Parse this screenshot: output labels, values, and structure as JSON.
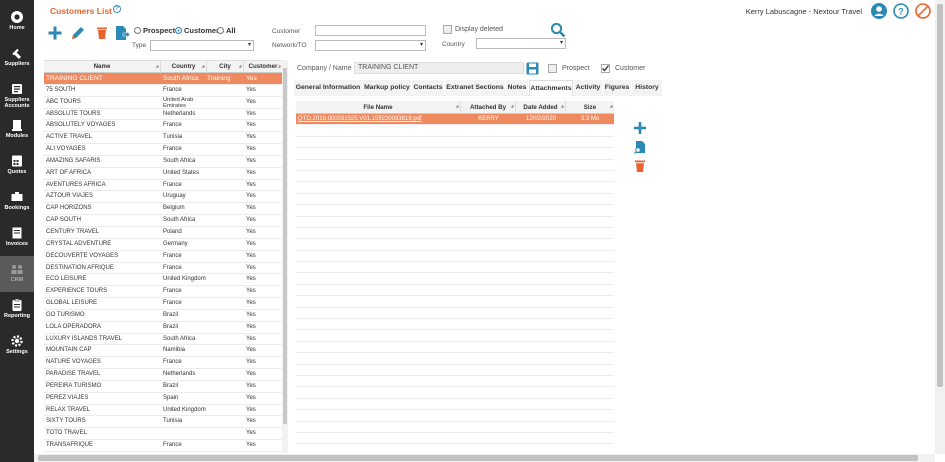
{
  "app": {
    "page_title": "Customers List",
    "user_name": "Kerry Labuscagne - Nextour Travel"
  },
  "colors": {
    "accent": "#e8632f",
    "selected_row": "#ef8a5e",
    "brand_blue": "#2a8ab5",
    "nav_bg": "#2a2a2a",
    "danger": "#e8632f"
  },
  "nav": [
    {
      "label": "Home",
      "icon": "home-icon"
    },
    {
      "label": "Suppliers",
      "icon": "suppliers-icon"
    },
    {
      "label": "Suppliers Accounts",
      "icon": "suppliers-accounts-icon"
    },
    {
      "label": "Modules",
      "icon": "modules-icon"
    },
    {
      "label": "Quotes",
      "icon": "quotes-icon"
    },
    {
      "label": "Bookings",
      "icon": "bookings-icon"
    },
    {
      "label": "Invoices",
      "icon": "invoices-icon"
    },
    {
      "label": "CRM",
      "icon": "crm-icon"
    },
    {
      "label": "Reporting",
      "icon": "reporting-icon"
    },
    {
      "label": "Settings",
      "icon": "settings-icon"
    }
  ],
  "filters": {
    "radio_prospect": "Prospect",
    "radio_customer": "Customer",
    "radio_all": "All",
    "type_label": "Type",
    "customer_label": "Customer",
    "network_label": "Network/TO",
    "display_deleted": "Display deleted",
    "country_label": "Country"
  },
  "list": {
    "headers": {
      "name": "Name",
      "country": "Country",
      "city": "City",
      "customer": "Customer"
    },
    "rows": [
      {
        "name": "TRAINING CLIENT",
        "country": "South Africa",
        "city": "Training",
        "customer": "Yes",
        "selected": true
      },
      {
        "name": "75 SOUTH",
        "country": "France",
        "city": "",
        "customer": "Yes"
      },
      {
        "name": "ABC TOURS",
        "country": "United Arab Emirates",
        "city": "",
        "customer": "Yes"
      },
      {
        "name": "ABSOLUTE TOURS",
        "country": "Netherlands",
        "city": "",
        "customer": "Yes"
      },
      {
        "name": "ABSOLUTELY VOYAGES",
        "country": "France",
        "city": "",
        "customer": "Yes"
      },
      {
        "name": "ACTIVE TRAVEL",
        "country": "Tunisia",
        "city": "",
        "customer": "Yes"
      },
      {
        "name": "ALI VOYAGES",
        "country": "France",
        "city": "",
        "customer": "Yes"
      },
      {
        "name": "AMAZING SAFARIS",
        "country": "South Africa",
        "city": "",
        "customer": "Yes"
      },
      {
        "name": "ART OF AFRICA",
        "country": "United States",
        "city": "",
        "customer": "Yes"
      },
      {
        "name": "AVENTURES AFRICA",
        "country": "France",
        "city": "",
        "customer": "Yes"
      },
      {
        "name": "AZTOUR VIAJES",
        "country": "Uruguay",
        "city": "",
        "customer": "Yes"
      },
      {
        "name": "CAP HORIZONS",
        "country": "Belgium",
        "city": "",
        "customer": "Yes"
      },
      {
        "name": "CAP SOUTH",
        "country": "South Africa",
        "city": "",
        "customer": "Yes"
      },
      {
        "name": "CENTURY TRAVEL",
        "country": "Poland",
        "city": "",
        "customer": "Yes"
      },
      {
        "name": "CRYSTAL ADVENTURE",
        "country": "Germany",
        "city": "",
        "customer": "Yes"
      },
      {
        "name": "DECOUVERTE VOYAGES",
        "country": "France",
        "city": "",
        "customer": "Yes"
      },
      {
        "name": "DESTINATION AFRIQUE",
        "country": "France",
        "city": "",
        "customer": "Yes"
      },
      {
        "name": "ECO LEISURE",
        "country": "United Kingdom",
        "city": "",
        "customer": "Yes"
      },
      {
        "name": "EXPERIENCE TOURS",
        "country": "France",
        "city": "",
        "customer": "Yes"
      },
      {
        "name": "GLOBAL LEISURE",
        "country": "France",
        "city": "",
        "customer": "Yes"
      },
      {
        "name": "GO TURISMO",
        "country": "Brazil",
        "city": "",
        "customer": "Yes"
      },
      {
        "name": "LOLA OPERADORA",
        "country": "Brazil",
        "city": "",
        "customer": "Yes"
      },
      {
        "name": "LUXURY ISLANDS TRAVEL",
        "country": "South Africa",
        "city": "",
        "customer": "Yes"
      },
      {
        "name": "MOUNTAIN CAP",
        "country": "Namibia",
        "city": "",
        "customer": "Yes"
      },
      {
        "name": "NATURE VOYAGES",
        "country": "France",
        "city": "",
        "customer": "Yes"
      },
      {
        "name": "PARADISE TRAVEL",
        "country": "Netherlands",
        "city": "",
        "customer": "Yes"
      },
      {
        "name": "PEREIRA TURISMO",
        "country": "Brazil",
        "city": "",
        "customer": "Yes"
      },
      {
        "name": "PEREZ VIAJES",
        "country": "Spain",
        "city": "",
        "customer": "Yes"
      },
      {
        "name": "RELAX TRAVEL",
        "country": "United Kingdom",
        "city": "",
        "customer": "Yes"
      },
      {
        "name": "SIXTY TOURS",
        "country": "Tunisia",
        "city": "",
        "customer": "Yes"
      },
      {
        "name": "TOTO TRAVEL",
        "country": "",
        "city": "",
        "customer": "Yes"
      },
      {
        "name": "TRANSAFRIQUE",
        "country": "France",
        "city": "",
        "customer": "Yes"
      }
    ]
  },
  "detail": {
    "company_label": "Company / Name",
    "company_value": "TRAINING CLIENT",
    "prospect_label": "Prospect",
    "customer_label": "Customer",
    "tabs": [
      "General Information",
      "Markup policy",
      "Contacts",
      "Extranet Sections",
      "Notes",
      "Attachments",
      "Activity",
      "Figures",
      "History"
    ],
    "active_tab": "Attachments",
    "attachments": {
      "headers": {
        "file_name": "File Name",
        "attached_by": "Attached By",
        "date_added": "Date Added",
        "size": "Size"
      },
      "rows": [
        {
          "file_name": "QTO.2018.000031525.V01.159220093819.pdf",
          "attached_by": "KERRY",
          "date_added": "12/02/2020",
          "size": "3.3 Mo"
        }
      ]
    }
  }
}
